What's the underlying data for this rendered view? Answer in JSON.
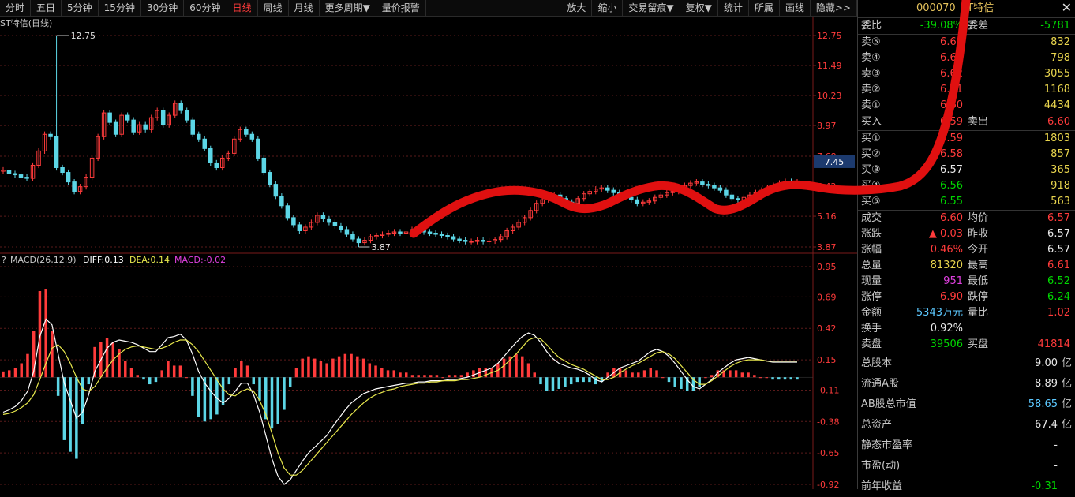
{
  "toolbar": {
    "left": [
      {
        "label": "分时",
        "active": false
      },
      {
        "label": "五日",
        "active": false
      },
      {
        "label": "5分钟",
        "active": false
      },
      {
        "label": "15分钟",
        "active": false
      },
      {
        "label": "30分钟",
        "active": false
      },
      {
        "label": "60分钟",
        "active": false
      },
      {
        "label": "日线",
        "active": true
      },
      {
        "label": "周线",
        "active": false
      },
      {
        "label": "月线",
        "active": false
      },
      {
        "label": "更多周期▼",
        "active": false
      },
      {
        "label": "量价报警",
        "active": false
      }
    ],
    "right": [
      "放大",
      "缩小",
      "交易留痕▼",
      "复权▼",
      "统计",
      "所属",
      "画线",
      "隐藏>>"
    ]
  },
  "chart_title": "ST特信(日线)",
  "macd_legend": {
    "name": "MACD(26,12,9)",
    "diff": "DIFF:0.13",
    "dea": "DEA:0.14",
    "macd": "MACD:-0.02"
  },
  "colors": {
    "up": "#ff3b3b",
    "down": "#5cd6e6",
    "diff": "#ffffff",
    "dea": "#e8e84d",
    "grid": "#5a1a1a",
    "axis_text": "#ff3b3b",
    "scribble": "#e01010"
  },
  "chart_data": [
    {
      "type": "candlestick",
      "title": "ST特信(日线)",
      "y_ticks": [
        "12.75",
        "11.49",
        "10.23",
        "8.97",
        "7.68",
        "6.42",
        "5.16",
        "3.87"
      ],
      "y_values": [
        12.75,
        11.49,
        10.23,
        8.97,
        7.68,
        6.42,
        5.16,
        3.87
      ],
      "ylim": [
        3.87,
        12.75
      ],
      "current_price_label": "7.45",
      "current_price": 7.45,
      "annotations": [
        {
          "text": "12.75",
          "value": 12.75
        },
        {
          "text": "3.87",
          "value": 3.87
        }
      ],
      "close": [
        7.1,
        6.95,
        6.9,
        6.8,
        6.75,
        7.3,
        7.9,
        8.6,
        8.5,
        7.2,
        7.0,
        6.6,
        6.2,
        6.4,
        6.8,
        7.6,
        8.5,
        9.5,
        9.1,
        8.6,
        9.4,
        9.2,
        8.7,
        9.0,
        8.8,
        9.3,
        9.6,
        9.0,
        9.4,
        9.9,
        9.6,
        9.2,
        8.6,
        8.4,
        8.0,
        7.4,
        7.2,
        7.6,
        7.8,
        8.4,
        8.8,
        8.6,
        8.4,
        7.6,
        7.0,
        6.5,
        6.0,
        5.6,
        5.1,
        4.8,
        4.55,
        4.7,
        4.9,
        5.2,
        5.05,
        4.9,
        4.75,
        4.6,
        4.4,
        4.2,
        4.05,
        4.15,
        4.3,
        4.35,
        4.4,
        4.45,
        4.5,
        4.45,
        4.5,
        4.6,
        4.55,
        4.5,
        4.45,
        4.4,
        4.35,
        4.3,
        4.2,
        4.15,
        4.1,
        4.1,
        4.15,
        4.1,
        4.12,
        4.18,
        4.3,
        4.55,
        4.7,
        4.9,
        5.1,
        5.4,
        5.7,
        5.85,
        6.0,
        6.05,
        5.9,
        5.75,
        5.7,
        5.9,
        6.1,
        6.2,
        6.3,
        6.35,
        6.25,
        6.15,
        6.05,
        5.95,
        5.85,
        5.7,
        5.75,
        5.8,
        5.95,
        6.05,
        6.15,
        6.2,
        6.35,
        6.45,
        6.55,
        6.6,
        6.5,
        6.45,
        6.35,
        6.25,
        6.05,
        5.9,
        5.85,
        5.95,
        6.05,
        6.15,
        6.25,
        6.35,
        6.45,
        6.55,
        6.62,
        6.57,
        6.6
      ],
      "index_of_high": 9,
      "index_of_low": 60
    },
    {
      "type": "line+bar",
      "title": "MACD(26,12,9)",
      "y_ticks": [
        "0.95",
        "0.69",
        "0.42",
        "0.15",
        "-0.11",
        "-0.38",
        "-0.65",
        "-0.92"
      ],
      "y_values": [
        0.95,
        0.69,
        0.42,
        0.15,
        -0.11,
        -0.38,
        -0.65,
        -0.92
      ],
      "ylim": [
        -0.92,
        0.95
      ],
      "series": [
        {
          "name": "DIFF",
          "values": [
            -0.3,
            -0.28,
            -0.25,
            -0.2,
            -0.12,
            0.05,
            0.35,
            0.5,
            0.45,
            0.2,
            -0.05,
            -0.2,
            -0.35,
            -0.3,
            -0.15,
            0.05,
            0.15,
            0.25,
            0.3,
            0.32,
            0.31,
            0.3,
            0.28,
            0.25,
            0.22,
            0.22,
            0.28,
            0.34,
            0.35,
            0.37,
            0.32,
            0.2,
            0.05,
            -0.05,
            -0.12,
            -0.18,
            -0.22,
            -0.18,
            -0.12,
            -0.05,
            -0.05,
            -0.15,
            -0.3,
            -0.5,
            -0.7,
            -0.85,
            -0.92,
            -0.88,
            -0.8,
            -0.72,
            -0.65,
            -0.6,
            -0.55,
            -0.5,
            -0.42,
            -0.35,
            -0.28,
            -0.22,
            -0.18,
            -0.14,
            -0.12,
            -0.1,
            -0.09,
            -0.08,
            -0.07,
            -0.06,
            -0.05,
            -0.05,
            -0.04,
            -0.04,
            -0.03,
            -0.03,
            -0.03,
            -0.02,
            -0.02,
            -0.01,
            0.0,
            0.02,
            0.04,
            0.06,
            0.08,
            0.12,
            0.18,
            0.24,
            0.3,
            0.35,
            0.38,
            0.36,
            0.3,
            0.22,
            0.16,
            0.12,
            0.1,
            0.08,
            0.07,
            0.05,
            0.02,
            -0.02,
            -0.04,
            0.0,
            0.04,
            0.08,
            0.1,
            0.12,
            0.14,
            0.18,
            0.22,
            0.24,
            0.22,
            0.18,
            0.12,
            0.05,
            -0.02,
            -0.08,
            -0.1,
            -0.06,
            -0.02,
            0.04,
            0.08,
            0.12,
            0.15,
            0.16,
            0.17,
            0.16,
            0.15,
            0.14,
            0.13,
            0.13,
            0.13,
            0.13,
            0.13
          ]
        },
        {
          "name": "DEA",
          "values": [
            -0.32,
            -0.31,
            -0.29,
            -0.26,
            -0.22,
            -0.15,
            -0.02,
            0.12,
            0.25,
            0.28,
            0.22,
            0.12,
            0.0,
            -0.1,
            -0.12,
            -0.08,
            0.0,
            0.08,
            0.15,
            0.2,
            0.24,
            0.26,
            0.27,
            0.26,
            0.25,
            0.24,
            0.25,
            0.27,
            0.3,
            0.32,
            0.32,
            0.28,
            0.22,
            0.14,
            0.06,
            -0.02,
            -0.1,
            -0.15,
            -0.16,
            -0.12,
            -0.1,
            -0.12,
            -0.2,
            -0.32,
            -0.48,
            -0.65,
            -0.78,
            -0.84,
            -0.84,
            -0.8,
            -0.74,
            -0.68,
            -0.62,
            -0.56,
            -0.5,
            -0.44,
            -0.38,
            -0.32,
            -0.27,
            -0.22,
            -0.18,
            -0.15,
            -0.13,
            -0.11,
            -0.1,
            -0.08,
            -0.07,
            -0.06,
            -0.05,
            -0.05,
            -0.04,
            -0.04,
            -0.03,
            -0.03,
            -0.03,
            -0.02,
            -0.02,
            -0.01,
            0.0,
            0.02,
            0.04,
            0.06,
            0.1,
            0.15,
            0.2,
            0.26,
            0.32,
            0.34,
            0.33,
            0.28,
            0.22,
            0.17,
            0.14,
            0.11,
            0.09,
            0.07,
            0.04,
            0.01,
            -0.02,
            -0.02,
            0.0,
            0.04,
            0.07,
            0.1,
            0.12,
            0.15,
            0.18,
            0.21,
            0.22,
            0.2,
            0.16,
            0.1,
            0.04,
            -0.02,
            -0.06,
            -0.06,
            -0.03,
            0.01,
            0.05,
            0.09,
            0.12,
            0.14,
            0.15,
            0.15,
            0.15,
            0.14,
            0.14,
            0.14,
            0.14,
            0.14,
            0.14
          ]
        }
      ],
      "histogram": [
        0.05,
        0.06,
        0.08,
        0.12,
        0.2,
        0.4,
        0.74,
        0.76,
        0.4,
        -0.16,
        -0.54,
        -0.64,
        -0.7,
        -0.4,
        -0.06,
        0.26,
        0.3,
        0.34,
        0.3,
        0.24,
        0.14,
        0.08,
        0.02,
        -0.02,
        -0.06,
        -0.04,
        0.06,
        0.14,
        0.1,
        0.1,
        0.0,
        -0.16,
        -0.34,
        -0.38,
        -0.36,
        -0.32,
        -0.24,
        -0.06,
        0.08,
        0.14,
        0.1,
        -0.06,
        -0.2,
        -0.36,
        -0.44,
        -0.4,
        -0.28,
        -0.08,
        0.08,
        0.16,
        0.18,
        0.16,
        0.14,
        0.12,
        0.16,
        0.18,
        0.2,
        0.2,
        0.18,
        0.16,
        0.12,
        0.1,
        0.08,
        0.06,
        0.06,
        0.04,
        0.04,
        0.02,
        0.02,
        0.02,
        0.02,
        0.02,
        0.0,
        0.02,
        0.02,
        0.02,
        0.04,
        0.06,
        0.08,
        0.08,
        0.08,
        0.12,
        0.16,
        0.18,
        0.2,
        0.18,
        0.12,
        0.04,
        -0.06,
        -0.12,
        -0.12,
        -0.1,
        -0.08,
        -0.06,
        -0.04,
        -0.04,
        -0.04,
        -0.06,
        -0.04,
        0.04,
        0.08,
        0.08,
        0.06,
        0.04,
        0.04,
        0.06,
        0.08,
        0.06,
        0.0,
        -0.04,
        -0.08,
        -0.1,
        -0.12,
        -0.12,
        -0.08,
        0.0,
        0.02,
        0.06,
        0.06,
        0.06,
        0.06,
        0.04,
        0.04,
        0.02,
        0.0,
        0.0,
        -0.02,
        -0.02,
        -0.02,
        -0.02,
        -0.02
      ]
    }
  ],
  "quote": {
    "code": "000070",
    "name": "ST特信",
    "weibi": {
      "label": "委比",
      "value": "-39.08%",
      "label2": "委差",
      "value2": "-5781"
    },
    "asks": [
      {
        "label": "卖⑤",
        "price": "6.64",
        "vol": "832"
      },
      {
        "label": "卖④",
        "price": "6.63",
        "vol": "798"
      },
      {
        "label": "卖③",
        "price": "6.62",
        "vol": "3055"
      },
      {
        "label": "卖②",
        "price": "6.61",
        "vol": "1168"
      },
      {
        "label": "卖①",
        "price": "6.60",
        "vol": "4434"
      }
    ],
    "trade": {
      "buy_label": "买入",
      "buy": "6.59",
      "sell_label": "卖出",
      "sell": "6.60"
    },
    "bids": [
      {
        "label": "买①",
        "price": "6.59",
        "vol": "1803",
        "color": "red"
      },
      {
        "label": "买②",
        "price": "6.58",
        "vol": "857",
        "color": "red"
      },
      {
        "label": "买③",
        "price": "6.57",
        "vol": "365",
        "color": "white"
      },
      {
        "label": "买④",
        "price": "6.56",
        "vol": "918",
        "color": "green"
      },
      {
        "label": "买⑤",
        "price": "6.55",
        "vol": "563",
        "color": "green"
      }
    ],
    "stats": [
      {
        "l1": "成交",
        "v1": "6.60",
        "c1": "red",
        "l2": "均价",
        "v2": "6.57",
        "c2": "red"
      },
      {
        "l1": "涨跌",
        "v1": "▲ 0.03",
        "c1": "red",
        "l2": "昨收",
        "v2": "6.57",
        "c2": "white"
      },
      {
        "l1": "涨幅",
        "v1": "0.46%",
        "c1": "red",
        "l2": "今开",
        "v2": "6.57",
        "c2": "white"
      },
      {
        "l1": "总量",
        "v1": "81320",
        "c1": "yellow",
        "l2": "最高",
        "v2": "6.61",
        "c2": "red"
      },
      {
        "l1": "现量",
        "v1": "951",
        "c1": "magenta",
        "l2": "最低",
        "v2": "6.52",
        "c2": "green"
      },
      {
        "l1": "涨停",
        "v1": "6.90",
        "c1": "red",
        "l2": "跌停",
        "v2": "6.24",
        "c2": "green"
      },
      {
        "l1": "金额",
        "v1": "5343万元",
        "c1": "cyan",
        "l2": "量比",
        "v2": "1.02",
        "c2": "red"
      },
      {
        "l1": "换手",
        "v1": "0.92%",
        "c1": "white",
        "l2": "",
        "v2": "",
        "c2": "white"
      },
      {
        "l1": "卖盘",
        "v1": "39506",
        "c1": "green",
        "l2": "买盘",
        "v2": "41814",
        "c2": "red"
      }
    ],
    "info": [
      {
        "label": "总股本",
        "value": "9.00",
        "unit": "亿",
        "color": "white"
      },
      {
        "label": "流通A股",
        "value": "8.89",
        "unit": "亿",
        "color": "white"
      },
      {
        "label": "AB股总市值",
        "value": "58.65",
        "unit": "亿",
        "color": "cyan"
      },
      {
        "label": "总资产",
        "value": "67.4",
        "unit": "亿",
        "color": "white"
      },
      {
        "label": "静态市盈率",
        "value": "-",
        "unit": "",
        "color": "white"
      },
      {
        "label": "市盈(动)",
        "value": "-",
        "unit": "",
        "color": "white"
      },
      {
        "label": "前年收益",
        "value": "-0.31",
        "unit": "",
        "color": "green"
      }
    ]
  }
}
